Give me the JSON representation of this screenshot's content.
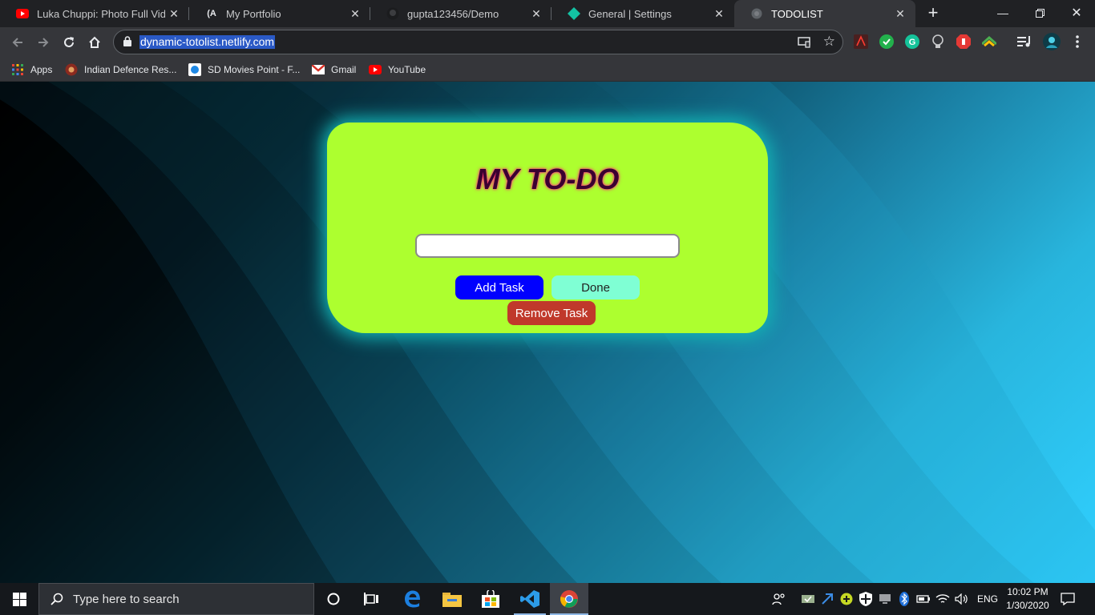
{
  "browser": {
    "tabs": [
      {
        "title": "Luka Chuppi: Photo Full Video",
        "icon": "youtube-icon"
      },
      {
        "title": "My Portfolio",
        "icon": "portfolio-icon"
      },
      {
        "title": "gupta123456/Demo",
        "icon": "github-icon"
      },
      {
        "title": "General | Settings",
        "icon": "settings-diamond-icon"
      },
      {
        "title": "TODOLIST",
        "icon": "globe-icon",
        "active": true
      }
    ],
    "address": "dynamic-totolist.netlify.com",
    "bookmarks": [
      {
        "label": "Apps",
        "icon": "apps-grid-icon"
      },
      {
        "label": "Indian Defence Res...",
        "icon": "drdo-icon"
      },
      {
        "label": "SD Movies Point - F...",
        "icon": "sd-movies-icon"
      },
      {
        "label": "Gmail",
        "icon": "gmail-icon"
      },
      {
        "label": "YouTube",
        "icon": "youtube-icon"
      }
    ]
  },
  "app": {
    "title": "MY TO-DO",
    "task_input_value": "",
    "buttons": {
      "add": "Add Task",
      "done": "Done",
      "remove": "Remove Task"
    },
    "colors": {
      "card": "#adff2f",
      "add": "#0000ff",
      "done": "#7fffd4",
      "remove": "#c0392b",
      "glow": "#13b3b5"
    }
  },
  "taskbar": {
    "search_placeholder": "Type here to search",
    "language": "ENG",
    "time": "10:02 PM",
    "date": "1/30/2020"
  }
}
